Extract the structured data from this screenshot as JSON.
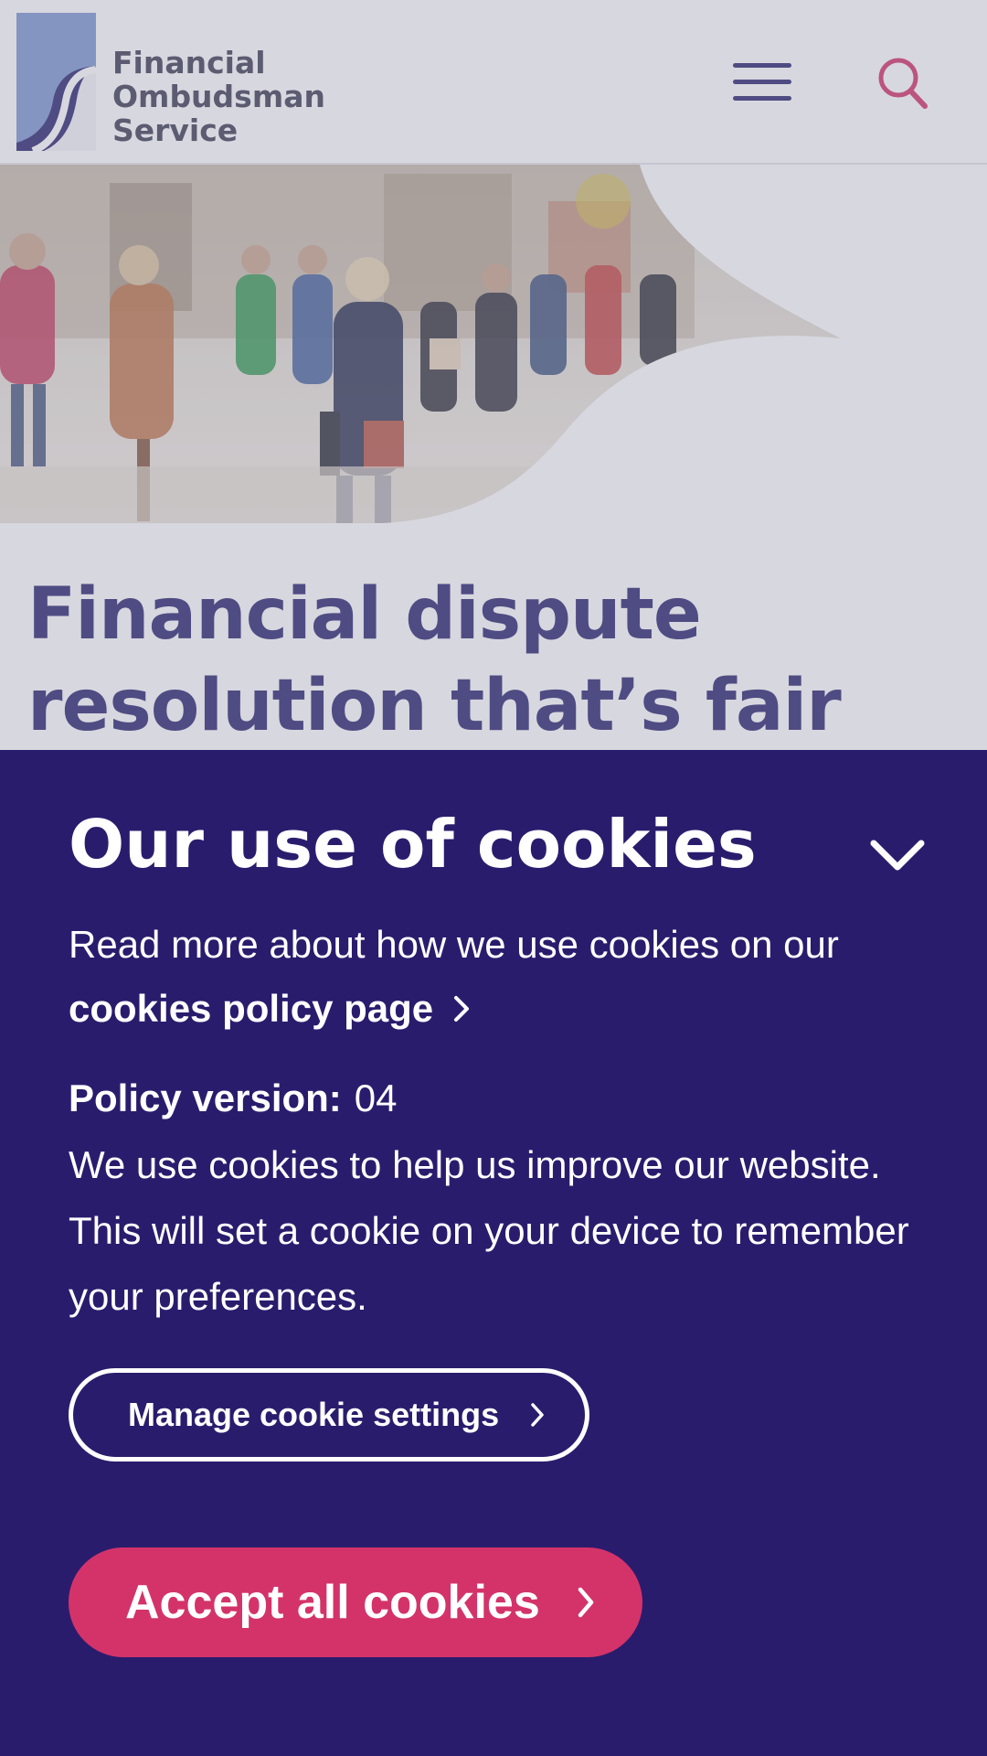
{
  "header": {
    "logo_lines": [
      "Financial",
      "Ombudsman",
      "Service"
    ],
    "menu_icon": "hamburger-menu-icon",
    "search_icon": "search-icon"
  },
  "hero": {
    "image": "blurred-crowd-street-photo"
  },
  "headline": "Financial dispute resolution that’s fair and",
  "cookie_banner": {
    "title": "Our use of cookies",
    "collapse_icon": "chevron-down-icon",
    "intro": "Read more about how we use cookies on our",
    "policy_link": "cookies policy page",
    "version_label": "Policy version:",
    "version_value": "04",
    "body": "We use cookies to help us improve our website. This will set a cookie on your device to remember your preferences.",
    "manage_button": "Manage cookie settings",
    "accept_button": "Accept all cookies"
  },
  "colors": {
    "brand_navy": "#2b2670",
    "banner_bg": "#2a1c6d",
    "accent_pink": "#d4336a",
    "logo_blue": "#7f98d0"
  }
}
